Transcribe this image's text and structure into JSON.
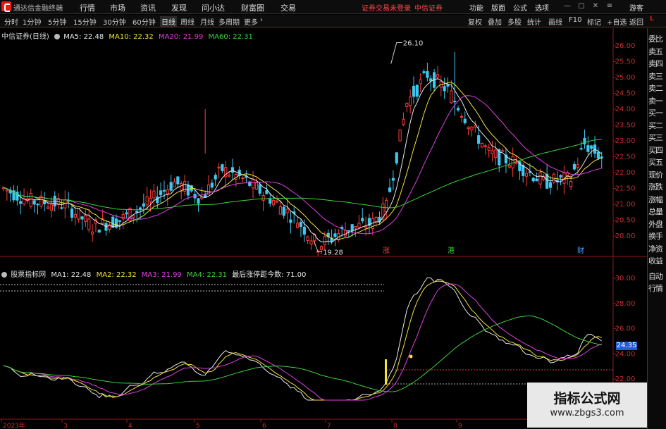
{
  "app": {
    "title": "通达信金融终端"
  },
  "menu": [
    "行情",
    "市场",
    "资讯",
    "发现",
    "问小达",
    "财富圈",
    "交易"
  ],
  "status": {
    "login_warning": "证券交易未登录",
    "broker": "中信证券"
  },
  "top_right": [
    "功能",
    "版面",
    "公式",
    "选项",
    "游客"
  ],
  "periods": [
    "分时",
    "1分钟",
    "5分钟",
    "15分钟",
    "30分钟",
    "60分钟",
    "日线",
    "周线",
    "月线",
    "多周期",
    "更多"
  ],
  "active_period": "日线",
  "chart_tools": [
    "复权",
    "叠加",
    "多股",
    "统计",
    "画线",
    "F10",
    "标记",
    "+自选",
    "返回"
  ],
  "main_legend": {
    "title": "中信证券(日线)",
    "ma5": "MA5: 22.48",
    "ma10": "MA10: 22.32",
    "ma20": "MA20: 21.99",
    "ma60": "MA60: 22.31"
  },
  "indicator_legend": {
    "title": "股票指标网",
    "ma1": "MA1: 22.48",
    "ma2": "MA2: 22.32",
    "ma3": "MA3: 21.99",
    "ma4": "MA4: 22.31",
    "note": "最后涨停距今数: 71.00"
  },
  "price_axis": [
    "26.00",
    "25.50",
    "25.00",
    "24.50",
    "24.00",
    "23.50",
    "23.00",
    "22.50",
    "22.00",
    "21.50",
    "21.00",
    "20.50",
    "20.00"
  ],
  "indicator_axis": [
    "30.00",
    "28.00",
    "26.00",
    "24.00",
    "22.00"
  ],
  "current_price_tag": "24.35",
  "high_label": "26.10",
  "low_label": "19.28",
  "event_markers": [
    {
      "label": "涨",
      "color": "#ff3b3b"
    },
    {
      "label": "港",
      "color": "#35d235"
    },
    {
      "label": "财",
      "color": "#4fa3ff"
    }
  ],
  "time_axis": [
    "2023年",
    "3",
    "4",
    "5",
    "6",
    "7",
    "8",
    "9"
  ],
  "side_panel": [
    "L",
    "委比",
    "卖五",
    "卖四",
    "卖三",
    "卖二",
    "卖一",
    "买一",
    "买二",
    "买三",
    "买四",
    "买五",
    "现价",
    "涨跌",
    "涨幅",
    "总量",
    "外盘",
    "换手",
    "净资",
    "收益",
    "自动",
    "行情"
  ],
  "watermark": {
    "title": "指标公式网",
    "url": "www.zbgs3.com"
  },
  "colors": {
    "up": "#ff3b3b",
    "down": "#3cc8f0",
    "ma5": "#e8e8e8",
    "ma10": "#f2e23a",
    "ma20": "#e040e0",
    "ma60": "#3cd23c",
    "frame": "#8b1a1a"
  }
}
